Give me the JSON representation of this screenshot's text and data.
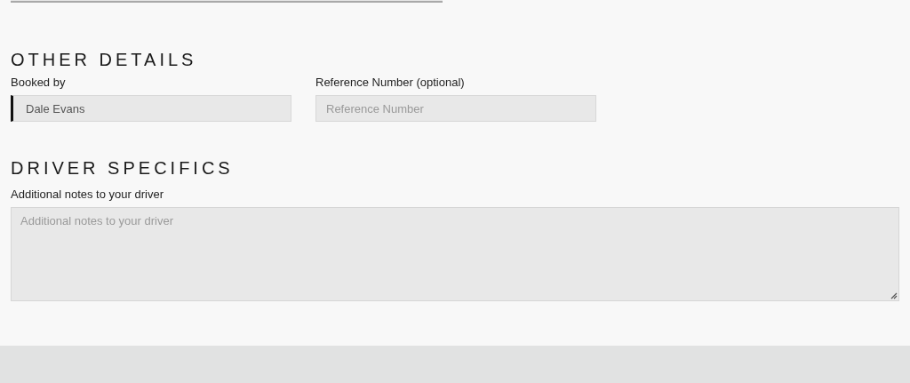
{
  "sections": [
    {
      "heading": "OTHER DETAILS",
      "kind": "row",
      "fields": [
        {
          "label": "Booked by",
          "value": "Dale Evans",
          "focused": true
        },
        {
          "label": "Reference Number (optional)",
          "placeholder": "Reference Number",
          "focused": false
        }
      ]
    },
    {
      "heading": "DRIVER SPECIFICS",
      "kind": "notes",
      "fields": [
        {
          "label": "Additional notes to your driver",
          "placeholder": "Additional notes to your driver",
          "focused": false
        }
      ]
    }
  ]
}
